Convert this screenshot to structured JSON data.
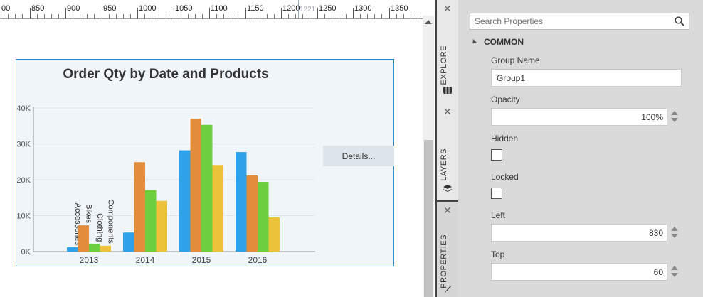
{
  "ruler": {
    "labels": [
      "00",
      "850",
      "900",
      "950",
      "1000",
      "1050",
      "1100",
      "1150",
      "1200",
      "1250",
      "1300",
      "1350",
      "140"
    ],
    "cursor_label": "1221"
  },
  "chart": {
    "details_label": "Details..."
  },
  "chart_data": {
    "type": "bar",
    "title": "Order Qty by Date and Products",
    "categories": [
      "2013",
      "2014",
      "2015",
      "2016"
    ],
    "y_ticks": [
      "0K",
      "10K",
      "20K",
      "30K",
      "40K"
    ],
    "ylim": [
      0,
      40000
    ],
    "grid": true,
    "series": [
      {
        "name": "Accessories",
        "color": "#2ea1e8",
        "values": [
          1200,
          5300,
          28200,
          27700
        ]
      },
      {
        "name": "Bikes",
        "color": "#e38d3c",
        "values": [
          7300,
          24900,
          37000,
          21200
        ]
      },
      {
        "name": "Clothing",
        "color": "#6dcf3e",
        "values": [
          2100,
          17100,
          35300,
          19400
        ]
      },
      {
        "name": "Components",
        "color": "#ebc23a",
        "values": [
          1600,
          14100,
          24100,
          9500
        ]
      }
    ]
  },
  "tabs": {
    "explore": "EXPLORE",
    "layers": "LAYERS",
    "properties": "PROPERTIES",
    "close_glyph": "✕"
  },
  "panel": {
    "search_placeholder": "Search Properties",
    "section": "COMMON",
    "group_name_label": "Group Name",
    "group_name_value": "Group1",
    "opacity_label": "Opacity",
    "opacity_value": "100%",
    "hidden_label": "Hidden",
    "locked_label": "Locked",
    "left_label": "Left",
    "left_value": "830",
    "top_label": "Top",
    "top_value": "60"
  }
}
